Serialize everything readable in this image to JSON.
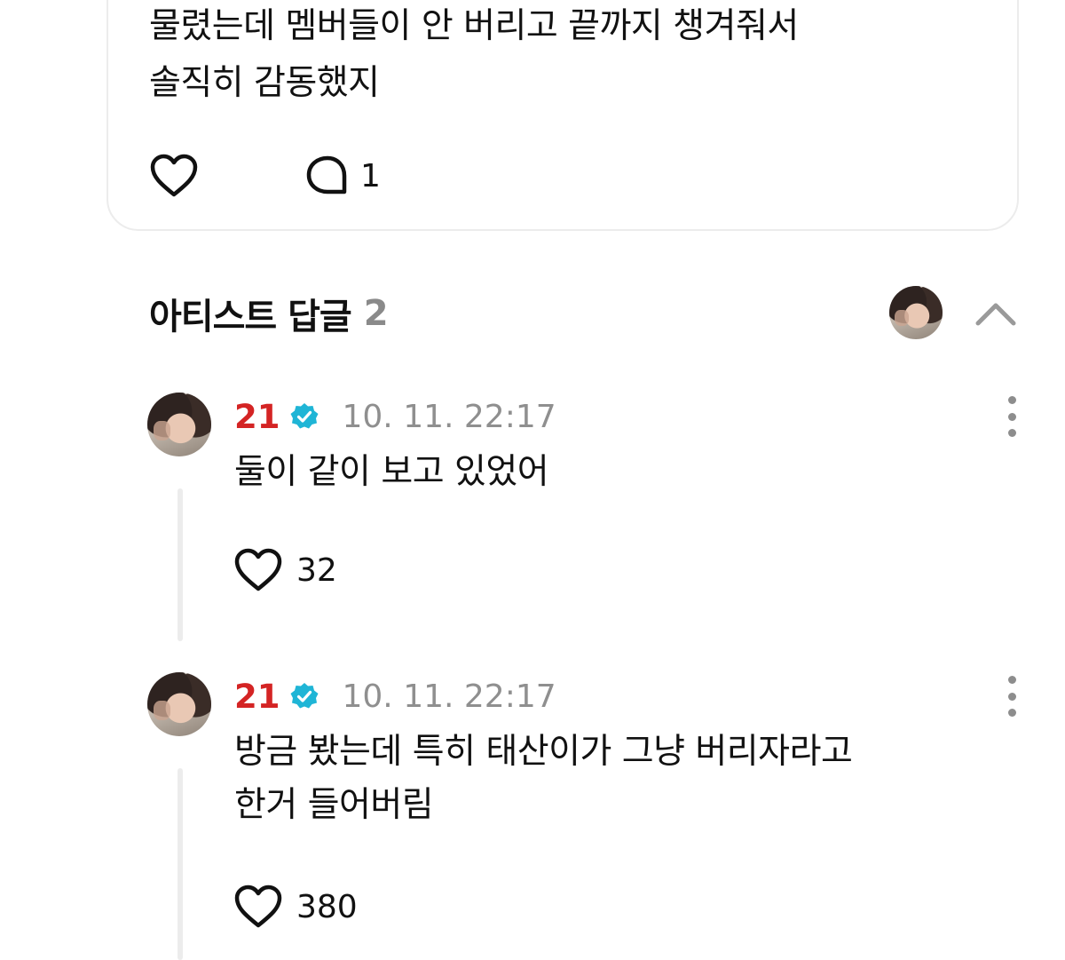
{
  "post": {
    "text_lines": "물렸는데 멤버들이 안 버리고 끝까지 챙겨줘서\n솔직히 감동했지",
    "comment_count": "1"
  },
  "artist_replies": {
    "title": "아티스트 답글",
    "count": "2"
  },
  "replies": [
    {
      "author": "21",
      "time": "10. 11. 22:17",
      "text": "둘이 같이 보고 있었어",
      "likes": "32"
    },
    {
      "author": "21",
      "time": "10. 11. 22:17",
      "text": "방금 봤는데 특히 태산이가 그냥 버리자라고\n한거 들어버림",
      "likes": "380"
    }
  ],
  "colors": {
    "author": "#d42424",
    "verified": "#1fb5d6",
    "muted": "#8f8f8f"
  },
  "icons": [
    "heart-icon",
    "comment-bubble-icon",
    "verified-badge-icon",
    "more-vertical-icon",
    "chevron-up-icon"
  ]
}
